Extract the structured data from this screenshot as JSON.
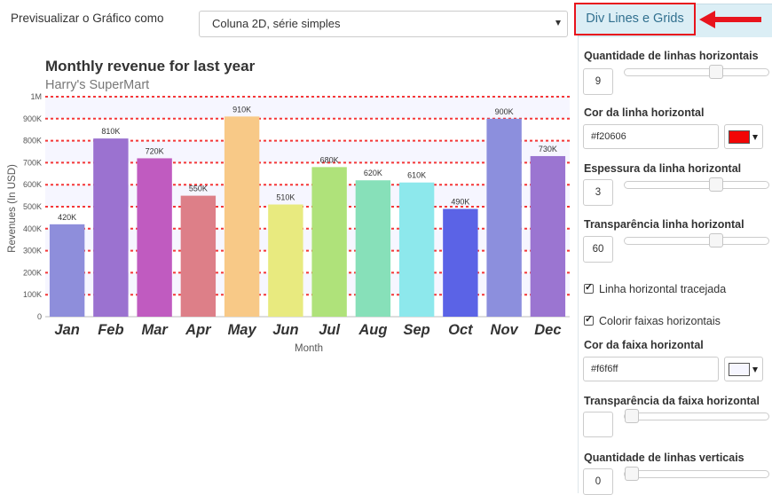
{
  "preview": {
    "label": "Previsualizar o Gráfico como",
    "selected": "Coluna 2D, série simples"
  },
  "panel": {
    "tab_label": "Div Lines e Grids",
    "controls": {
      "h_lines_count": {
        "label": "Quantidade de linhas horizontais",
        "value": "9",
        "slider_fraction": 0.65
      },
      "h_line_color": {
        "label": "Cor da linha horizontal",
        "value": "#f20606",
        "swatch": "#f20606"
      },
      "h_line_thickness": {
        "label": "Espessura da linha horizontal",
        "value": "3",
        "slider_fraction": 0.65
      },
      "h_line_alpha": {
        "label": "Transparência linha horizontal",
        "value": "60",
        "slider_fraction": 0.65
      },
      "dashed": {
        "label": "Linha horizontal tracejada",
        "checked": true
      },
      "color_bands": {
        "label": "Colorir faixas horizontais",
        "checked": true
      },
      "band_color": {
        "label": "Cor da faixa horizontal",
        "value": "#f6f6ff",
        "swatch": "#f6f6ff"
      },
      "band_alpha": {
        "label": "Transparência da faixa horizontal",
        "value": "",
        "slider_fraction": 0.0
      },
      "v_lines_count": {
        "label": "Quantidade de linhas verticais",
        "value": "0",
        "slider_fraction": 0.0
      }
    }
  },
  "chart_data": {
    "type": "bar",
    "title": "Monthly revenue for last year",
    "subtitle": "Harry's SuperMart",
    "xlabel": "Month",
    "ylabel": "Revenues (In USD)",
    "ylim": [
      0,
      1000000
    ],
    "y_ticks": [
      "0",
      "100K",
      "200K",
      "300K",
      "400K",
      "500K",
      "600K",
      "700K",
      "800K",
      "900K",
      "1M"
    ],
    "categories": [
      "Jan",
      "Feb",
      "Mar",
      "Apr",
      "May",
      "Jun",
      "Jul",
      "Aug",
      "Sep",
      "Oct",
      "Nov",
      "Dec"
    ],
    "values": [
      420000,
      810000,
      720000,
      550000,
      910000,
      510000,
      680000,
      620000,
      610000,
      490000,
      900000,
      730000
    ],
    "value_labels": [
      "420K",
      "810K",
      "720K",
      "550K",
      "910K",
      "510K",
      "680K",
      "620K",
      "610K",
      "490K",
      "900K",
      "730K"
    ],
    "colors": [
      "#8e8edb",
      "#9b72d0",
      "#c05bc0",
      "#dd7f88",
      "#f8c987",
      "#e8ea7f",
      "#afe27a",
      "#87e0b9",
      "#8de8ec",
      "#5b63e6",
      "#8c8fdd",
      "#9b75d1"
    ],
    "div_line_color": "#f20606",
    "band_color": "#f6f6ff",
    "grid": true
  }
}
